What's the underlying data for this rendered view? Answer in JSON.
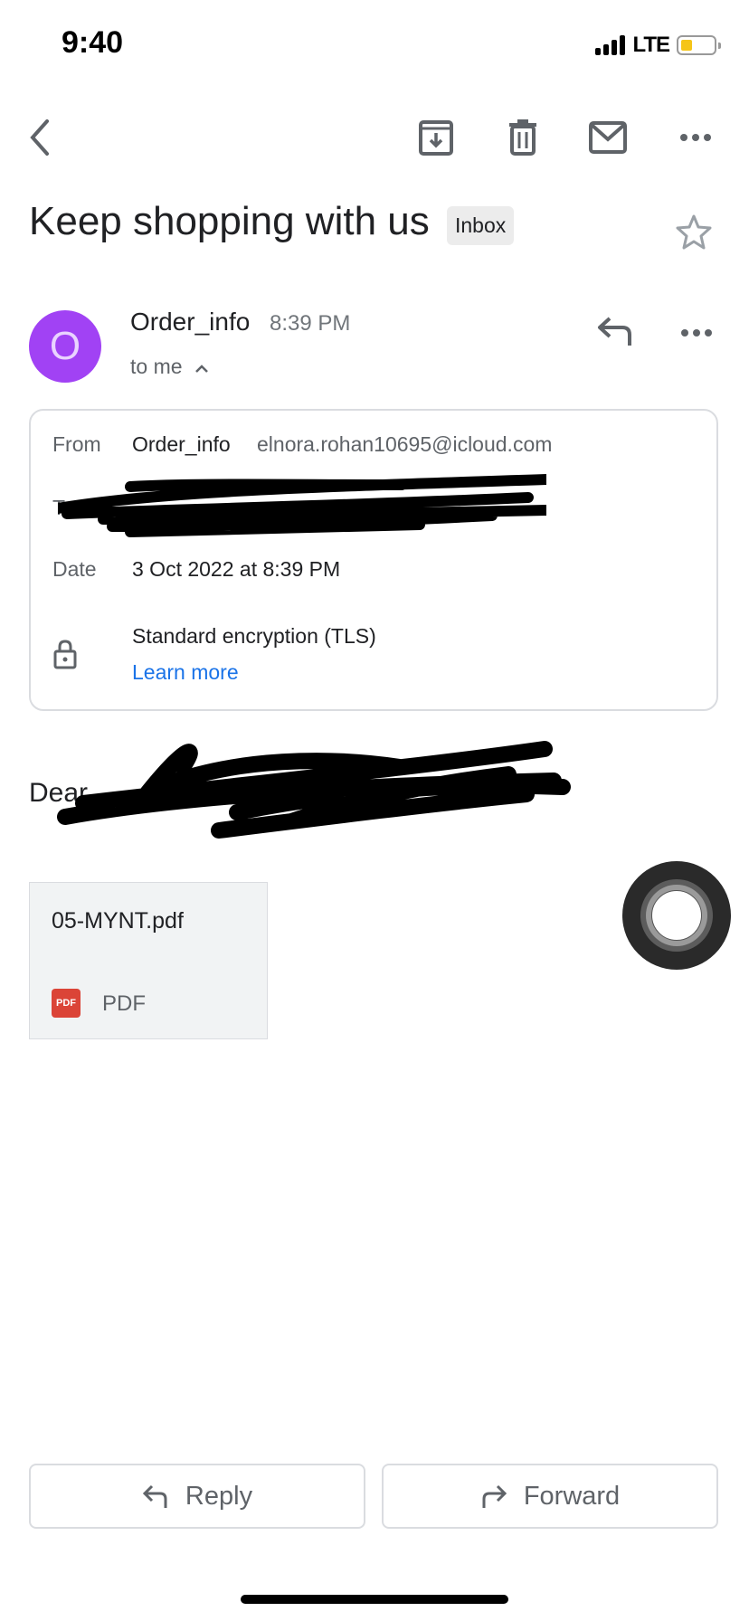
{
  "status_bar": {
    "time": "9:40",
    "network": "LTE",
    "signal_bars": 4,
    "battery_level": 0.35,
    "battery_color": "#f5c518"
  },
  "toolbar": {
    "icons": [
      "back-icon",
      "archive-icon",
      "delete-icon",
      "mark-unread-icon",
      "more-icon"
    ]
  },
  "email": {
    "subject": "Keep shopping with us",
    "label": "Inbox",
    "starred": false,
    "sender": {
      "name": "Order_info",
      "initial": "O",
      "avatar_color": "#a142f4",
      "time": "8:39 PM",
      "recipient_summary": "to me"
    },
    "details": {
      "from_label": "From",
      "from_name": "Order_info",
      "from_email": "elnora.rohan10695@icloud.com",
      "to_label": "To",
      "to_value": "[redacted]",
      "date_label": "Date",
      "date_value": "3 Oct 2022 at 8:39 PM",
      "encryption": "Standard encryption (TLS)",
      "learn_more": "Learn more"
    },
    "body_greeting": "Dear",
    "attachment": {
      "filename": "05-MYNT.pdf",
      "type_badge": "PDF",
      "type_label": "PDF"
    }
  },
  "actions": {
    "reply": "Reply",
    "forward": "Forward"
  }
}
